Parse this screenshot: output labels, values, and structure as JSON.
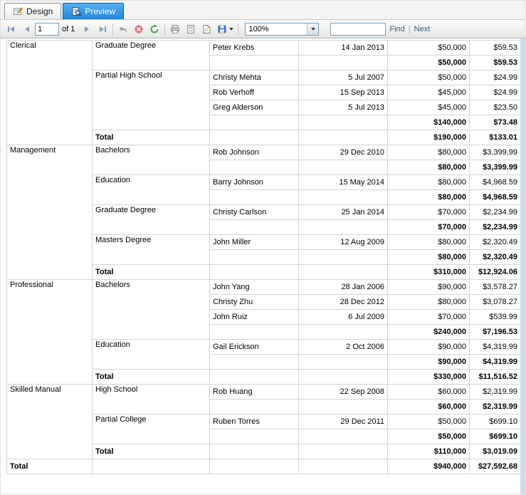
{
  "tabs": {
    "design": "Design",
    "preview": "Preview"
  },
  "toolbar": {
    "page_value": "1",
    "of_label": "of 1",
    "zoom_value": "100%",
    "find_value": "",
    "find_label": "Find",
    "separator": "|",
    "next_label": "Next",
    "icons": [
      "first-page-icon",
      "previous-page-icon",
      "next-page-icon",
      "last-page-icon",
      "back-to-parent-icon",
      "stop-icon",
      "refresh-icon",
      "print-icon",
      "print-layout-icon",
      "page-setup-icon",
      "export-icon",
      "zoom-dropdown-icon"
    ]
  },
  "colors": {
    "subtotal_bg": "#98A8C8",
    "total_bg": "#AFEBEB",
    "grand_total_bg": "#DDA0DD",
    "active_tab": "#1E86D8",
    "gutter": "#C8DCF0"
  },
  "report": {
    "total_label": "Total",
    "groups": [
      {
        "occupation": "Clerical",
        "education_groups": [
          {
            "education": "Graduate Degree",
            "details": [
              {
                "name": "Peter Krebs",
                "date": "14 Jan 2013",
                "salary": "$50,000",
                "sales": "$59.53"
              }
            ],
            "subtotal": {
              "salary": "$50,000",
              "sales": "$59.53"
            }
          },
          {
            "education": "Partial High School",
            "details": [
              {
                "name": "Christy Mehta",
                "date": "5 Jul 2007",
                "salary": "$50,000",
                "sales": "$24.99"
              },
              {
                "name": "Rob Verhoff",
                "date": "15 Sep 2013",
                "salary": "$45,000",
                "sales": "$24.99"
              },
              {
                "name": "Greg Alderson",
                "date": "5 Jul 2013",
                "salary": "$45,000",
                "sales": "$23.50"
              }
            ],
            "subtotal": {
              "salary": "$140,000",
              "sales": "$73.48"
            }
          }
        ],
        "total": {
          "salary": "$190,000",
          "sales": "$133.01"
        }
      },
      {
        "occupation": "Management",
        "education_groups": [
          {
            "education": "Bachelors",
            "details": [
              {
                "name": "Rob Johnson",
                "date": "29 Dec 2010",
                "salary": "$80,000",
                "sales": "$3,399.99"
              }
            ],
            "subtotal": {
              "salary": "$80,000",
              "sales": "$3,399.99"
            }
          },
          {
            "education": "Education",
            "details": [
              {
                "name": "Barry Johnson",
                "date": "15 May 2014",
                "salary": "$80,000",
                "sales": "$4,968.59"
              }
            ],
            "subtotal": {
              "salary": "$80,000",
              "sales": "$4,968.59"
            }
          },
          {
            "education": "Graduate Degree",
            "details": [
              {
                "name": "Christy Carlson",
                "date": "25 Jan 2014",
                "salary": "$70,000",
                "sales": "$2,234.99"
              }
            ],
            "subtotal": {
              "salary": "$70,000",
              "sales": "$2,234.99"
            }
          },
          {
            "education": "Masters Degree",
            "details": [
              {
                "name": "John Miller",
                "date": "12 Aug 2009",
                "salary": "$80,000",
                "sales": "$2,320.49"
              }
            ],
            "subtotal": {
              "salary": "$80,000",
              "sales": "$2,320.49"
            }
          }
        ],
        "total": {
          "salary": "$310,000",
          "sales": "$12,924.06"
        }
      },
      {
        "occupation": "Professional",
        "education_groups": [
          {
            "education": "Bachelors",
            "details": [
              {
                "name": "John Yang",
                "date": "28 Jan 2006",
                "salary": "$90,000",
                "sales": "$3,578.27"
              },
              {
                "name": "Christy Zhu",
                "date": "28 Dec 2012",
                "salary": "$80,000",
                "sales": "$3,078.27"
              },
              {
                "name": "John Ruiz",
                "date": "6 Jul 2009",
                "salary": "$70,000",
                "sales": "$539.99"
              }
            ],
            "subtotal": {
              "salary": "$240,000",
              "sales": "$7,196.53"
            }
          },
          {
            "education": "Education",
            "details": [
              {
                "name": "Gail Erickson",
                "date": "2 Oct 2006",
                "salary": "$90,000",
                "sales": "$4,319.99"
              }
            ],
            "subtotal": {
              "salary": "$90,000",
              "sales": "$4,319.99"
            }
          }
        ],
        "total": {
          "salary": "$330,000",
          "sales": "$11,516.52"
        }
      },
      {
        "occupation": "Skilled Manual",
        "education_groups": [
          {
            "education": "High School",
            "details": [
              {
                "name": "Rob Huang",
                "date": "22 Sep 2008",
                "salary": "$60,000",
                "sales": "$2,319.99"
              }
            ],
            "subtotal": {
              "salary": "$60,000",
              "sales": "$2,319.99"
            }
          },
          {
            "education": "Partial College",
            "details": [
              {
                "name": "Ruben Torres",
                "date": "29 Dec 2011",
                "salary": "$50,000",
                "sales": "$699.10"
              }
            ],
            "subtotal": {
              "salary": "$50,000",
              "sales": "$699.10"
            }
          }
        ],
        "total": {
          "salary": "$110,000",
          "sales": "$3,019.09"
        }
      }
    ],
    "grand_total": {
      "salary": "$940,000",
      "sales": "$27,592.68"
    }
  }
}
